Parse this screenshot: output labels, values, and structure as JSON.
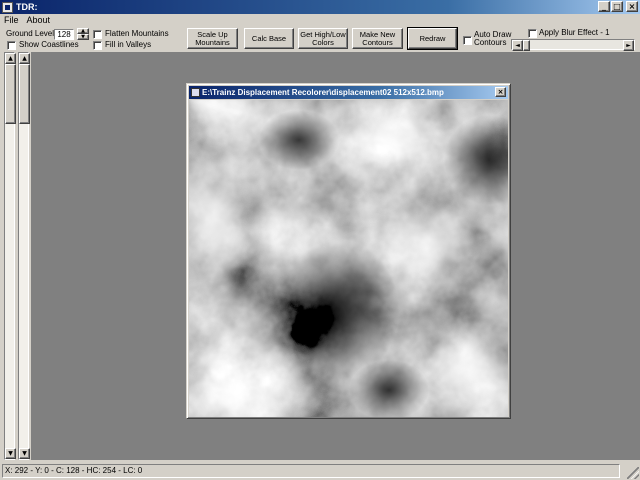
{
  "window": {
    "title": "TDR:",
    "controls": {
      "minimize": "_",
      "maximize": "□",
      "close": "×"
    }
  },
  "menu": [
    "File",
    "About"
  ],
  "toolbar": {
    "ground_level_label": "Ground Level",
    "ground_level_value": "128",
    "spinner_up": "▲",
    "spinner_down": "▼",
    "show_coastlines": {
      "label": "Show Coastlines",
      "checked": false
    },
    "flatten_mountains": {
      "label": "Flatten Mountains",
      "checked": false
    },
    "fill_valleys": {
      "label": "Fill in Valleys",
      "checked": false
    },
    "buttons": {
      "scale_up": "Scale Up\nMountains",
      "calc_base": "Calc Base",
      "get_colors": "Get High/Low\nColors",
      "new_contours": "Make New\nContours",
      "redraw": "Redraw"
    },
    "auto_draw": {
      "label": "Auto Draw\nContours",
      "checked": false
    },
    "apply_blur": {
      "label": "Apply Blur Effect - 1",
      "checked": false
    },
    "blur_slider": {
      "left_arrow": "◄",
      "right_arrow": "►",
      "level": 0
    }
  },
  "scrollbars": {
    "up_arrow": "▲",
    "down_arrow": "▼"
  },
  "image_window": {
    "title": "E:\\Trainz Displacement Recolorer\\displacement02 512x512.bmp",
    "close": "×",
    "image": "grayscale terrain displacement heightmap"
  },
  "status": {
    "text": "X: 292 - Y: 0 - C: 128 - HC: 254 - LC: 0"
  },
  "colors": {
    "window_bg": "#d4d0c8",
    "title_active": "#0a246a",
    "title_gradient_end": "#a6caf0",
    "workspace": "#808080"
  }
}
